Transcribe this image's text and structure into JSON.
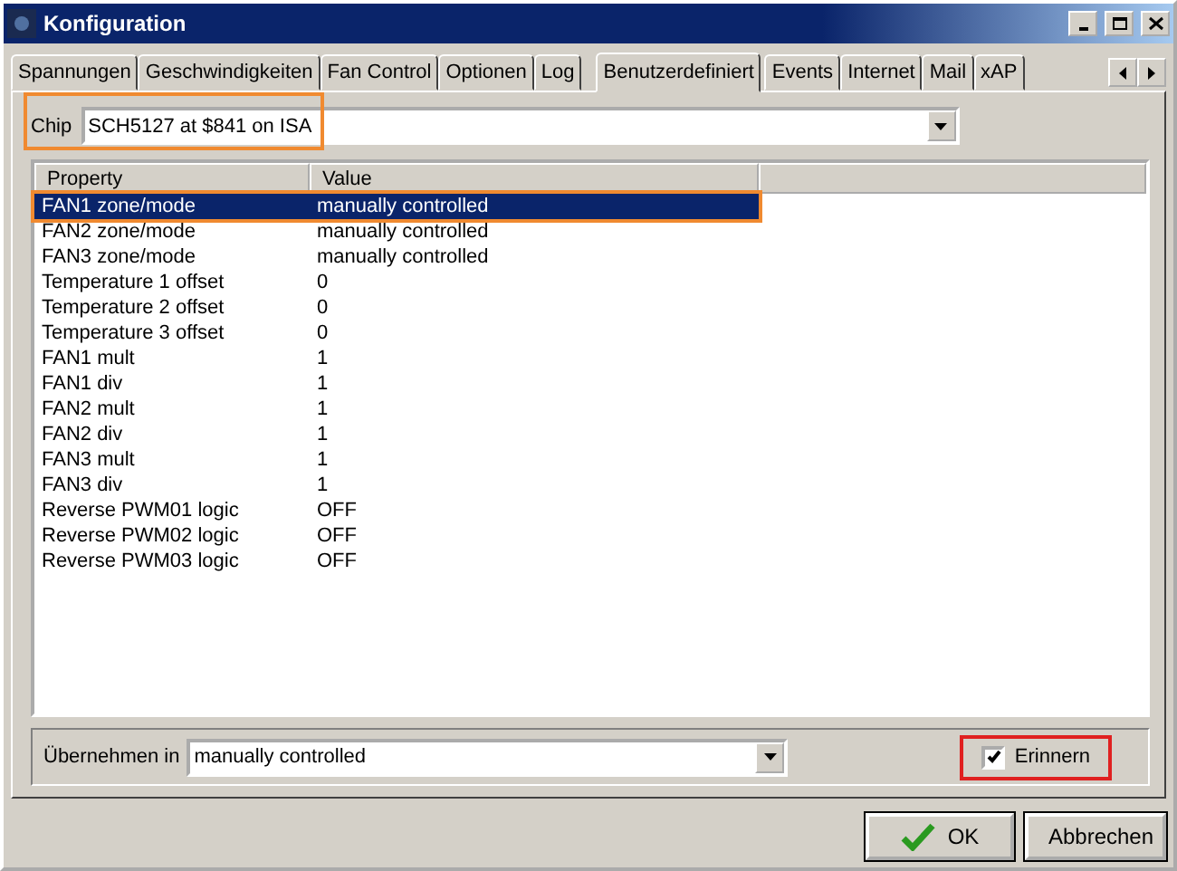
{
  "window": {
    "title": "Konfiguration"
  },
  "tabs": [
    {
      "label": "Spannungen",
      "selected": false
    },
    {
      "label": "Geschwindigkeiten",
      "selected": false
    },
    {
      "label": "Fan Control",
      "selected": false
    },
    {
      "label": "Optionen",
      "selected": false
    },
    {
      "label": "Log",
      "selected": false
    },
    {
      "label": "Benutzerdefiniert",
      "selected": true
    },
    {
      "label": "Events",
      "selected": false
    },
    {
      "label": "Internet",
      "selected": false
    },
    {
      "label": "Mail",
      "selected": false
    },
    {
      "label": "xAP",
      "selected": false
    }
  ],
  "chip": {
    "label": "Chip",
    "value": "SCH5127 at $841 on ISA",
    "highlighted": true
  },
  "table": {
    "columns": [
      "Property",
      "Value"
    ],
    "rows": [
      {
        "property": "FAN1 zone/mode",
        "value": "manually controlled",
        "selected": true,
        "highlighted": true
      },
      {
        "property": "FAN2 zone/mode",
        "value": "manually controlled",
        "selected": false,
        "highlighted": false
      },
      {
        "property": "FAN3 zone/mode",
        "value": "manually controlled",
        "selected": false,
        "highlighted": false
      },
      {
        "property": "Temperature 1 offset",
        "value": "0",
        "selected": false,
        "highlighted": false
      },
      {
        "property": "Temperature 2 offset",
        "value": "0",
        "selected": false,
        "highlighted": false
      },
      {
        "property": "Temperature 3 offset",
        "value": "0",
        "selected": false,
        "highlighted": false
      },
      {
        "property": "FAN1 mult",
        "value": "1",
        "selected": false,
        "highlighted": false
      },
      {
        "property": "FAN1 div",
        "value": "1",
        "selected": false,
        "highlighted": false
      },
      {
        "property": "FAN2 mult",
        "value": "1",
        "selected": false,
        "highlighted": false
      },
      {
        "property": "FAN2 div",
        "value": "1",
        "selected": false,
        "highlighted": false
      },
      {
        "property": "FAN3 mult",
        "value": "1",
        "selected": false,
        "highlighted": false
      },
      {
        "property": "FAN3 div",
        "value": "1",
        "selected": false,
        "highlighted": false
      },
      {
        "property": "Reverse PWM01 logic",
        "value": "OFF",
        "selected": false,
        "highlighted": false
      },
      {
        "property": "Reverse PWM02 logic",
        "value": "OFF",
        "selected": false,
        "highlighted": false
      },
      {
        "property": "Reverse PWM03 logic",
        "value": "OFF",
        "selected": false,
        "highlighted": false
      }
    ]
  },
  "apply": {
    "label": "Übernehmen in",
    "value": "manually controlled"
  },
  "remember": {
    "label": "Erinnern",
    "checked": true,
    "highlighted": true
  },
  "buttons": [
    {
      "label": "OK",
      "kind": "ok"
    },
    {
      "label": "Abbrechen",
      "kind": "cancel"
    }
  ]
}
